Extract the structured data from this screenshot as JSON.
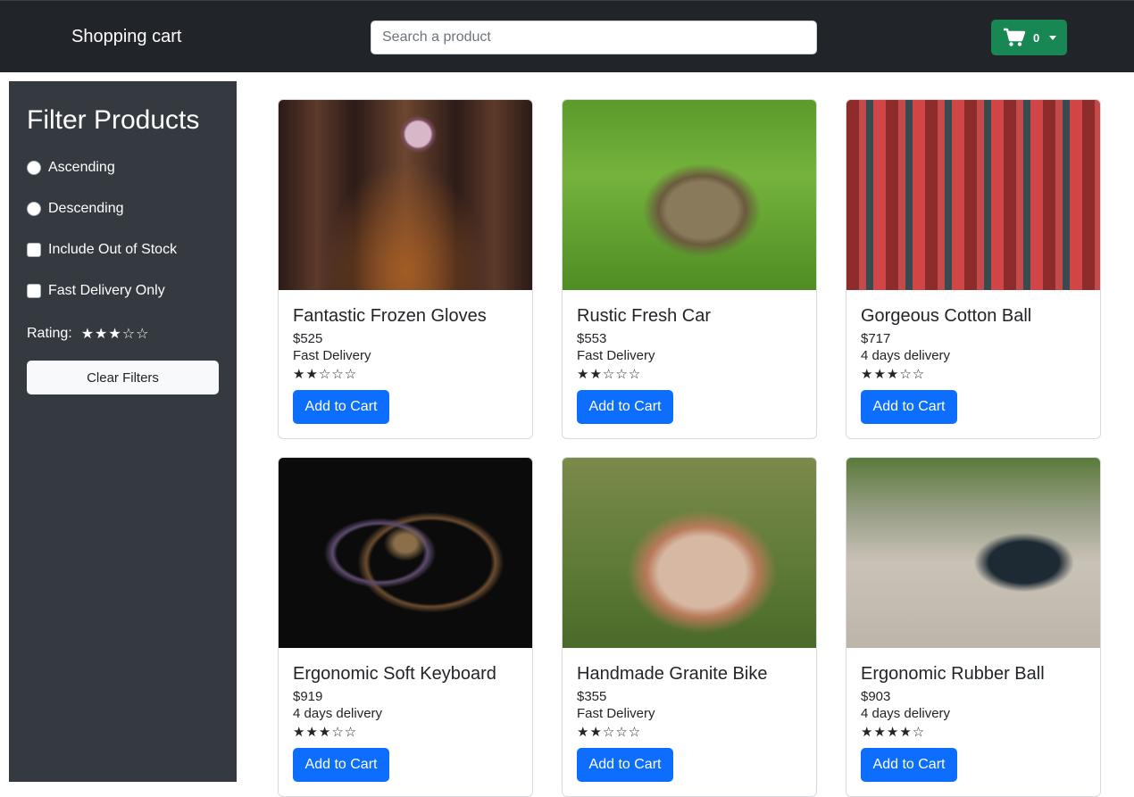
{
  "navbar": {
    "brand": "Shopping cart",
    "search_placeholder": "Search a product",
    "cart_count": "0",
    "cart_icon": "cart-icon",
    "cart_color": "#198754"
  },
  "filters": {
    "title": "Filter Products",
    "ascending": "Ascending",
    "descending": "Descending",
    "include_out_of_stock": "Include Out of Stock",
    "fast_delivery_only": "Fast Delivery Only",
    "rating_label": "Rating:",
    "rating_stars": "★★★☆☆",
    "rating_value": 3,
    "clear_button": "Clear Filters"
  },
  "products": [
    {
      "name": "Fantastic Frozen Gloves",
      "price": "$525",
      "delivery": "Fast Delivery",
      "stars": "★★☆☆☆",
      "rating": 2,
      "image": "cathedral",
      "button": "Add to Cart"
    },
    {
      "name": "Rustic Fresh Car",
      "price": "$553",
      "delivery": "Fast Delivery",
      "stars": "★★☆☆☆",
      "rating": 2,
      "image": "rabbit",
      "button": "Add to Cart"
    },
    {
      "name": "Gorgeous Cotton Ball",
      "price": "$717",
      "delivery": "4 days delivery",
      "stars": "★★★☆☆",
      "rating": 3,
      "image": "sausages",
      "button": "Add to Cart"
    },
    {
      "name": "Ergonomic Soft Keyboard",
      "price": "$919",
      "delivery": "4 days delivery",
      "stars": "★★★☆☆",
      "rating": 3,
      "image": "abstract",
      "button": "Add to Cart"
    },
    {
      "name": "Handmade Granite Bike",
      "price": "$355",
      "delivery": "Fast Delivery",
      "stars": "★★☆☆☆",
      "rating": 2,
      "image": "dog",
      "button": "Add to Cart"
    },
    {
      "name": "Ergonomic Rubber Ball",
      "price": "$903",
      "delivery": "4 days delivery",
      "stars": "★★★★☆",
      "rating": 4,
      "image": "cyclist",
      "button": "Add to Cart"
    }
  ],
  "colors": {
    "navbar": "#212529",
    "sidebar": "#343a40",
    "primary": "#0d6efd"
  }
}
